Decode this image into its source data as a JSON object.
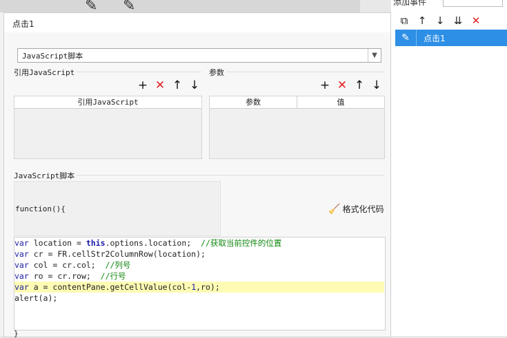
{
  "dialog": {
    "title": "点击1",
    "script_type": "JavaScript脚本",
    "ref_section_label": "引用JavaScript",
    "params_section_label": "参数",
    "ref_table_header": "引用JavaScript",
    "params_table_headers": [
      "参数",
      "值"
    ],
    "script_section_label": "JavaScript脚本",
    "function_header": "function(){",
    "format_button_label": "格式化代码",
    "closing_brace": "}",
    "code_lines": [
      "var location = this.options.location;  //获取当前控件的位置",
      "var cr = FR.cellStr2ColumnRow(location);",
      "var col = cr.col;  //列号",
      "var ro = cr.row;  //行号",
      "var a = contentPane.getCellValue(col-1,ro);",
      "alert(a);"
    ],
    "highlighted_line_index": 4
  },
  "events_panel": {
    "title": "添加事件",
    "items": [
      {
        "label": "点击1",
        "selected": true
      }
    ]
  },
  "icons": {
    "add": "plus-icon",
    "delete": "delete-icon",
    "move_up": "arrow-up-icon",
    "move_down": "arrow-down-icon",
    "copy": "copy-icon",
    "edit": "pencil-icon",
    "format": "broom-icon"
  },
  "colors": {
    "selection_blue": "#2d8fe5",
    "delete_red": "#e02020",
    "highlight_line": "#fdfbb4",
    "keyword": "#1a1aa6",
    "comment": "#118811"
  }
}
